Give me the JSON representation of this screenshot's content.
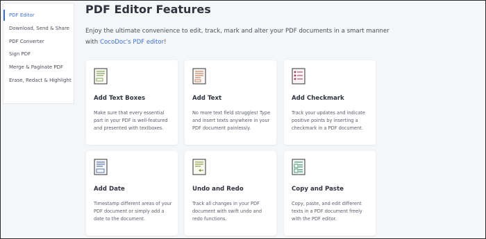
{
  "sidebar": {
    "items": [
      {
        "label": "PDF Editor",
        "active": true
      },
      {
        "label": "Download, Send & Share",
        "active": false
      },
      {
        "label": "PDF Converter",
        "active": false
      },
      {
        "label": "Sign PDF",
        "active": false
      },
      {
        "label": "Merge & Paginate PDF",
        "active": false
      },
      {
        "label": "Erase, Redact & Highlight",
        "active": false
      }
    ]
  },
  "main": {
    "title": "PDF Editor Features",
    "intro_text": "Enjoy the ultimate convenience to edit, track, mark and alter your PDF documents in a smart manner with ",
    "intro_link": "CocoDoc's PDF editor",
    "intro_end": "!"
  },
  "cards": [
    {
      "title": "Add Text Boxes",
      "desc": "Make sure that every essential part in your PDF is well-featured and presented with textboxes.",
      "icon": "text-box-document-icon",
      "accent": "#6a8f3a"
    },
    {
      "title": "Add Text",
      "desc": "No more text field struggles! Type and insert texts anywhere in your PDF document painlessly.",
      "icon": "text-document-icon",
      "accent": "#b86a4a"
    },
    {
      "title": "Add Checkmark",
      "desc": "Track your updates and indicate positive points by inserting a checkmark in a PDF document.",
      "icon": "checkmark-document-icon",
      "accent": "#9a3a5a"
    },
    {
      "title": "Add Date",
      "desc": "Timestamp different areas of your PDF document or simply add a date to the document.",
      "icon": "date-document-icon",
      "accent": "#3a5a9a"
    },
    {
      "title": "Undo and Redo",
      "desc": "Track all changes in your PDF document with swift undo and redo functions.",
      "icon": "undo-redo-document-icon",
      "accent": "#7a8a2a"
    },
    {
      "title": "Copy and Paste",
      "desc": "Copy, paste, and edit different texts in a PDF document freely with the PDF editor.",
      "icon": "copy-paste-document-icon",
      "accent": "#2a7a5a"
    }
  ]
}
